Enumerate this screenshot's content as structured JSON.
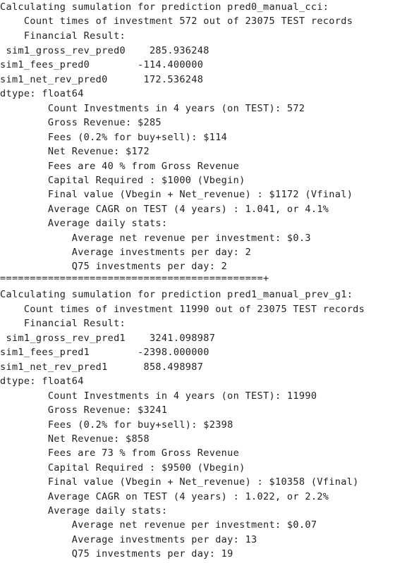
{
  "output": {
    "lines": [
      "Calculating sumulation for prediction pred0_manual_cci:",
      "    Count times of investment 572 out of 23075 TEST records",
      "    Financial Result:",
      " sim1_gross_rev_pred0    285.936248",
      "sim1_fees_pred0        -114.400000",
      "sim1_net_rev_pred0      172.536248",
      "dtype: float64",
      "        Count Investments in 4 years (on TEST): 572",
      "        Gross Revenue: $285",
      "        Fees (0.2% for buy+sell): $114",
      "        Net Revenue: $172",
      "        Fees are 40 % from Gross Revenue",
      "        Capital Required : $1000 (Vbegin)",
      "        Final value (Vbegin + Net_revenue) : $1172 (Vfinal)",
      "        Average CAGR on TEST (4 years) : 1.041, or 4.1%",
      "        Average daily stats:",
      "            Average net revenue per investment: $0.3",
      "            Average investments per day: 2",
      "            Q75 investments per day: 2",
      "============================================+",
      "Calculating sumulation for prediction pred1_manual_prev_g1:",
      "    Count times of investment 11990 out of 23075 TEST records",
      "    Financial Result:",
      " sim1_gross_rev_pred1    3241.098987",
      "sim1_fees_pred1        -2398.000000",
      "sim1_net_rev_pred1      858.498987",
      "dtype: float64",
      "        Count Investments in 4 years (on TEST): 11990",
      "        Gross Revenue: $3241",
      "        Fees (0.2% for buy+sell): $2398",
      "        Net Revenue: $858",
      "        Fees are 73 % from Gross Revenue",
      "        Capital Required : $9500 (Vbegin)",
      "        Final value (Vbegin + Net_revenue) : $10358 (Vfinal)",
      "        Average CAGR on TEST (4 years) : 1.022, or 2.2%",
      "        Average daily stats:",
      "            Average net revenue per investment: $0.07",
      "            Average investments per day: 13",
      "            Q75 investments per day: 19"
    ]
  }
}
